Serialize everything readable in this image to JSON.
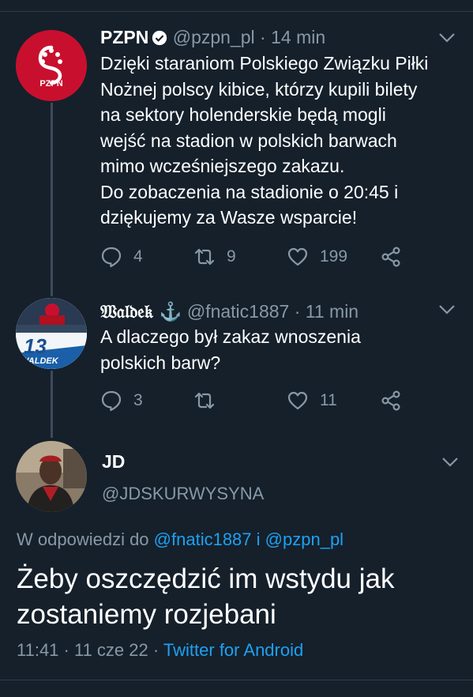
{
  "tweets": [
    {
      "name": "PZPN",
      "handle": "@pzpn_pl",
      "time": "· 14 min",
      "avatar_text": "PZPN",
      "text": "Dzięki staraniom Polskiego Związku Piłki\nNożnej polscy kibice, którzy kupili bilety\nna sektory holenderskie będą mogli\nwejść na stadion w polskich barwach\nmimo wcześniejszego zakazu.\nDo zobaczenia na stadionie o 20:45 i\ndziękujemy za Wasze wsparcie!",
      "replies": "4",
      "retweets": "9",
      "likes": "199"
    },
    {
      "name": "𝔚𝔞𝔩𝔡𝔢𝔨 ⚓",
      "handle": "@fnatic1887",
      "time": "· 11 min",
      "avatar_number": "13",
      "avatar_text": "WALDEK",
      "text": "A dlaczego był zakaz wnoszenia\npolskich barw?",
      "replies": "3",
      "retweets": "",
      "likes": "11"
    }
  ],
  "focused_tweet": {
    "name": "JD",
    "handle": "@JDSKURWYSYNA",
    "replying_prefix": "W odpowiedzi do",
    "replying_to_1": "@fnatic1887",
    "replying_and": "i",
    "replying_to_2": "@pzpn_pl",
    "text": "Żeby oszczędzić im wstydu jak zostaniemy rozjebani",
    "time": "11:41",
    "date": "11 cze 22",
    "source": "Twitter for Android"
  },
  "colors": {
    "background": "#15202b",
    "secondary_text": "#8899a6",
    "link": "#1da1f2",
    "pzpn_red": "#c8102e"
  }
}
